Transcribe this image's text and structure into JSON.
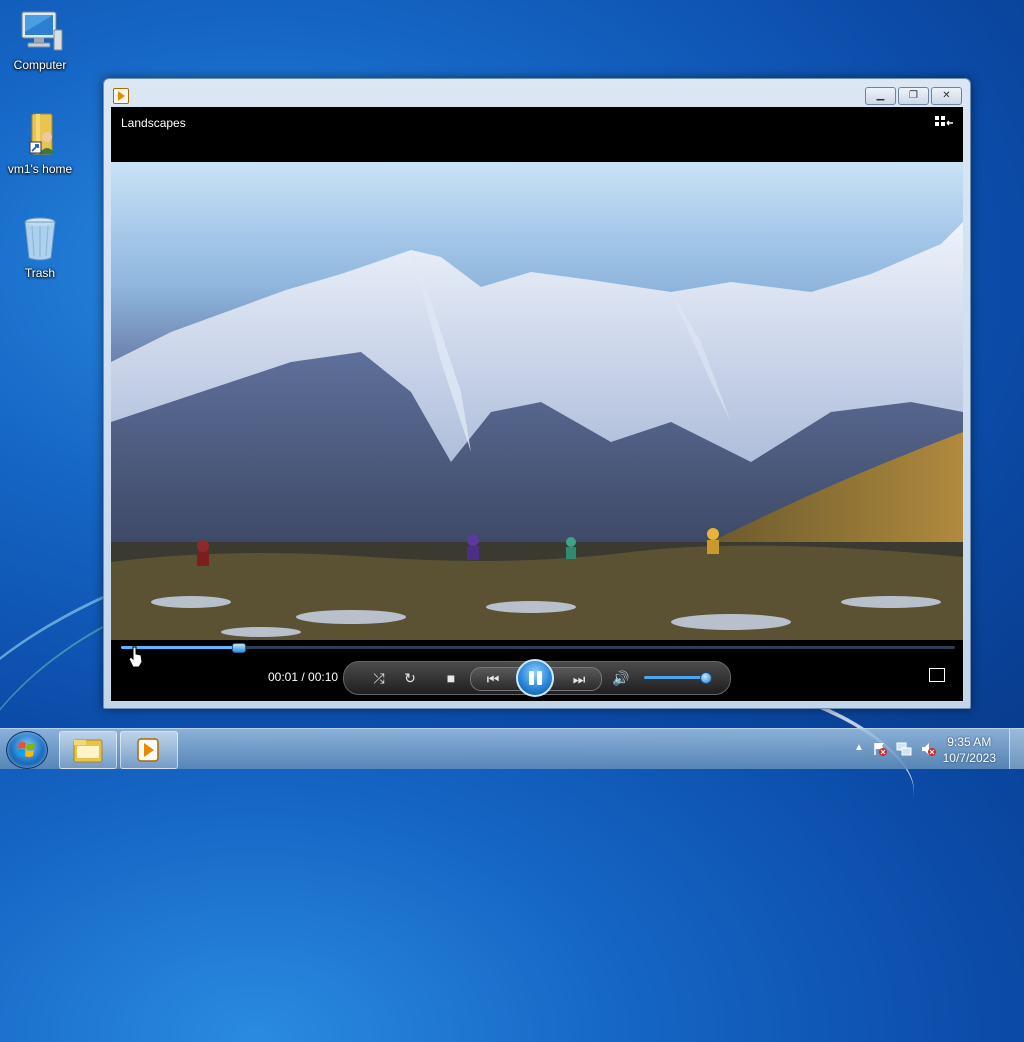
{
  "desktop": {
    "icons": [
      {
        "label": "Computer",
        "icon": "computer-icon"
      },
      {
        "label": "vm1's home",
        "icon": "home-folder-icon"
      },
      {
        "label": "Trash",
        "icon": "trash-icon"
      }
    ]
  },
  "window": {
    "app_icon": "media-player-icon",
    "buttons": {
      "minimize": "minimize-icon",
      "restore": "restore-icon",
      "close": "close-icon"
    }
  },
  "player": {
    "title": "Landscapes",
    "current_time": "00:01",
    "total_time": "00:10",
    "time_display": "00:01 / 00:10",
    "progress_fraction": 0.14,
    "volume_fraction": 0.9,
    "state": "playing",
    "icons": [
      "switch-to-library-icon",
      "shuffle-icon",
      "repeat-icon",
      "stop-icon",
      "previous-icon",
      "pause-icon",
      "next-icon",
      "volume-icon",
      "fullscreen-icon"
    ]
  },
  "taskbar": {
    "items": [
      {
        "name": "file-explorer",
        "icon": "folder-icon"
      },
      {
        "name": "media-player",
        "icon": "media-player-icon"
      }
    ],
    "tray": {
      "icons": [
        "show-hidden-icons-icon",
        "action-center-icon",
        "network-icon",
        "volume-muted-icon"
      ],
      "time": "9:35 AM",
      "date": "10/7/2023"
    }
  },
  "colors": {
    "accent": "#2b86d8",
    "seek_fill": "#5fb7ff"
  }
}
